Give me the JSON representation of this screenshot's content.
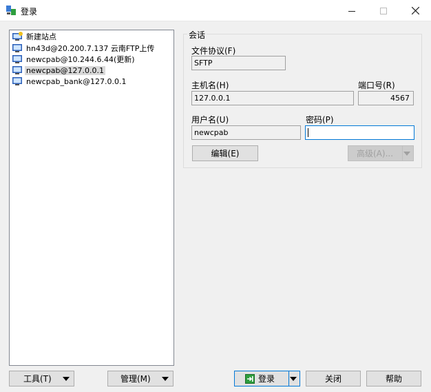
{
  "window": {
    "title": "登录"
  },
  "site_tree": {
    "items": [
      {
        "label": "新建站点",
        "icon": "new-site-icon",
        "selected": false
      },
      {
        "label": "hn43d@20.200.7.137 云南FTP上传",
        "icon": "computer-icon",
        "selected": false
      },
      {
        "label": "newcpab@10.244.6.44(更新)",
        "icon": "computer-icon",
        "selected": false
      },
      {
        "label": "newcpab@127.0.0.1",
        "icon": "computer-icon",
        "selected": true
      },
      {
        "label": "newcpab_bank@127.0.0.1",
        "icon": "computer-icon",
        "selected": false
      }
    ]
  },
  "session": {
    "group_title": "会话",
    "protocol_label": "文件协议(F)",
    "protocol_value": "SFTP",
    "host_label": "主机名(H)",
    "host_value": "127.0.0.1",
    "port_label": "端口号(R)",
    "port_value": "4567",
    "user_label": "用户名(U)",
    "user_value": "newcpab",
    "password_label": "密码(P)",
    "password_value": "",
    "edit_button": "编辑(E)",
    "advanced_button": "高级(A)..."
  },
  "footer": {
    "tools_button": "工具(T)",
    "manage_button": "管理(M)",
    "login_button": "登录",
    "close_button": "关闭",
    "help_button": "帮助"
  },
  "colors": {
    "accent": "#0078d7",
    "selection": "#d9d9d9",
    "login_icon_green": "#2e9e3e"
  }
}
